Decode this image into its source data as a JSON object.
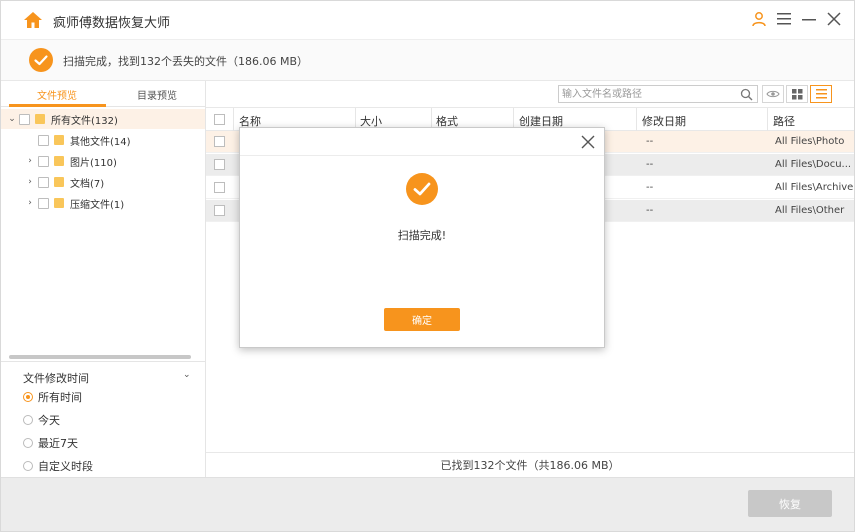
{
  "app": {
    "title": "疯师傅数据恢复大师"
  },
  "status": {
    "message": "扫描完成，找到132个丢失的文件（186.06 MB）"
  },
  "tabs": [
    {
      "label": "文件预览",
      "active": true
    },
    {
      "label": "目录预览",
      "active": false
    }
  ],
  "tree": [
    {
      "label": "所有文件(132)",
      "expanded": true
    },
    {
      "label": "其他文件(14)"
    },
    {
      "label": "图片(110)"
    },
    {
      "label": "文档(7)"
    },
    {
      "label": "压缩文件(1)"
    }
  ],
  "filter": {
    "title": "文件修改时间",
    "options": [
      {
        "label": "所有时间",
        "selected": true
      },
      {
        "label": "今天",
        "selected": false
      },
      {
        "label": "最近7天",
        "selected": false
      },
      {
        "label": "自定义时段",
        "selected": false
      }
    ]
  },
  "search": {
    "placeholder": "输入文件名或路径"
  },
  "table": {
    "columns": [
      "名称",
      "大小",
      "格式",
      "创建日期",
      "修改日期",
      "路径"
    ],
    "rows": [
      {
        "modified": "--",
        "path": "All Files\\Photo"
      },
      {
        "modified": "--",
        "path": "All Files\\Docu..."
      },
      {
        "modified": "--",
        "path": "All Files\\Archive"
      },
      {
        "modified": "--",
        "path": "All Files\\Other"
      }
    ]
  },
  "footer": {
    "summary": "已找到132个文件（共186.06 MB）"
  },
  "actions": {
    "recover": "恢复"
  },
  "dialog": {
    "message": "扫描完成!",
    "ok": "确定"
  },
  "colors": {
    "accent": "#f7941d",
    "selected_row": "#fdf1e6",
    "folder": "#f9c65a"
  }
}
